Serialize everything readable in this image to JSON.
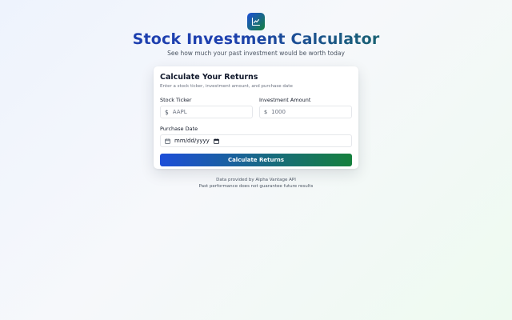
{
  "header": {
    "title": "Stock Investment Calculator",
    "subtitle": "See how much your past investment would be worth today"
  },
  "card": {
    "title": "Calculate Your Returns",
    "description": "Enter a stock ticker, investment amount, and purchase date",
    "ticker": {
      "label": "Stock Ticker",
      "prefix": "$",
      "placeholder": "AAPL"
    },
    "amount": {
      "label": "Investment Amount",
      "prefix": "$",
      "placeholder": "1000"
    },
    "date": {
      "label": "Purchase Date",
      "value": "mm/dd/yyyy"
    },
    "submit_label": "Calculate Returns"
  },
  "footer": {
    "line1": "Data provided by Alpha Vantage API",
    "line2": "Past performance does not guarantee future results"
  },
  "colors": {
    "accent_blue": "#1d4ed8",
    "accent_green": "#15803d"
  }
}
